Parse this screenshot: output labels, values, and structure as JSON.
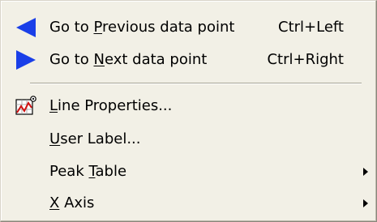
{
  "menu": {
    "items": [
      {
        "label_pre": "Go to ",
        "label_mnemonic": "P",
        "label_post": "revious data point",
        "shortcut": "Ctrl+Left",
        "icon": "left-triangle-icon"
      },
      {
        "label_pre": "Go to ",
        "label_mnemonic": "N",
        "label_post": "ext data point",
        "shortcut": "Ctrl+Right",
        "icon": "right-triangle-icon"
      },
      {
        "label_pre": "",
        "label_mnemonic": "L",
        "label_post": "ine Properties...",
        "icon": "line-properties-icon"
      },
      {
        "label_pre": "",
        "label_mnemonic": "U",
        "label_post": "ser Label..."
      },
      {
        "label_pre": "Peak ",
        "label_mnemonic": "T",
        "label_post": "able",
        "submenu": true
      },
      {
        "label_pre": "",
        "label_mnemonic": "X",
        "label_post": " Axis",
        "submenu": true
      }
    ]
  },
  "colors": {
    "menu_background": "#f2f0e6",
    "arrow_icon": "#1a3fe8",
    "separator": "#a7a496"
  }
}
